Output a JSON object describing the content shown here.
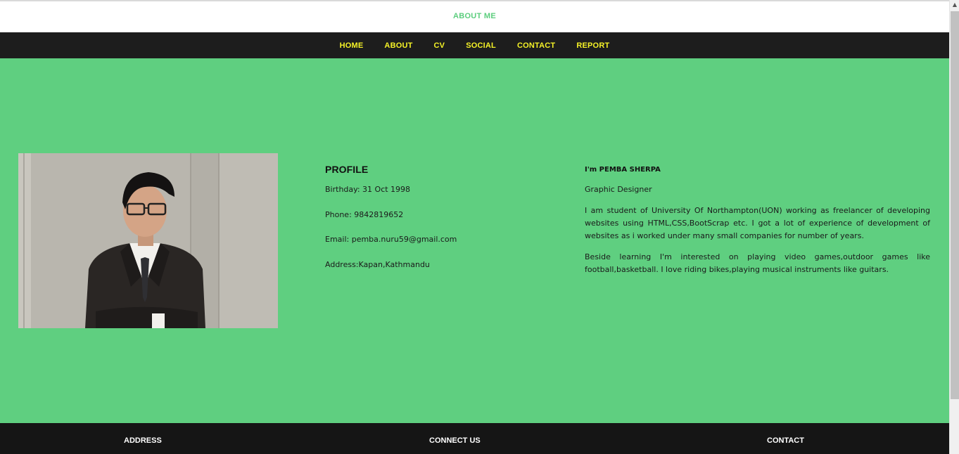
{
  "header": {
    "title": "ABOUT ME"
  },
  "nav": {
    "items": [
      {
        "label": "HOME"
      },
      {
        "label": "ABOUT"
      },
      {
        "label": "CV"
      },
      {
        "label": "SOCIAL"
      },
      {
        "label": "CONTACT"
      },
      {
        "label": "REPORT"
      }
    ]
  },
  "profile": {
    "heading": "PROFILE",
    "birthday": "Birthday: 31 Oct 1998",
    "phone": "Phone: 9842819652",
    "email": "Email: pemba.nuru59@gmail.com",
    "address": "Address:Kapan,Kathmandu"
  },
  "bio": {
    "name": "I'm PEMBA SHERPA",
    "role": "Graphic Designer",
    "para1": "I am student of University Of Northampton(UON) working as freelancer of developing websites using HTML,CSS,BootScrap etc. I got a lot of experience of development of websites as i worked under many small companies for number of years.",
    "para2": "Beside learning I'm interested on playing video games,outdoor games like football,basketball. I love riding bikes,playing musical instruments like guitars."
  },
  "footer": {
    "address": "ADDRESS",
    "connect": "CONNECT US",
    "contact": "CONTACT"
  },
  "colors": {
    "accent_green": "#5fcf80",
    "nav_text": "#f5f227",
    "dark": "#1d1d1d"
  }
}
